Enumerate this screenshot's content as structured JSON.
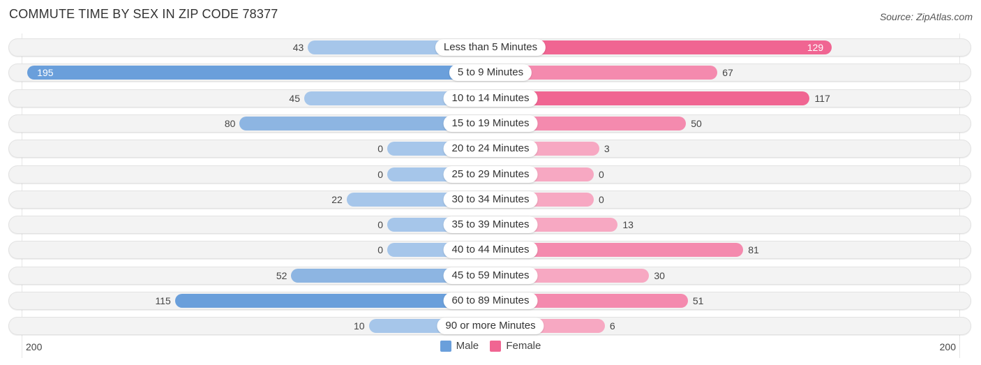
{
  "header": {
    "title": "COMMUTE TIME BY SEX IN ZIP CODE 78377",
    "source": "Source: ZipAtlas.com"
  },
  "colors": {
    "male": "#6a9fdb",
    "male_light": "#a6c6ea",
    "female": "#f06592",
    "female_light": "#f7a8c2"
  },
  "chart_data": {
    "type": "bar",
    "orientation": "horizontal-diverging",
    "title": "COMMUTE TIME BY SEX IN ZIP CODE 78377",
    "categories": [
      "Less than 5 Minutes",
      "5 to 9 Minutes",
      "10 to 14 Minutes",
      "15 to 19 Minutes",
      "20 to 24 Minutes",
      "25 to 29 Minutes",
      "30 to 34 Minutes",
      "35 to 39 Minutes",
      "40 to 44 Minutes",
      "45 to 59 Minutes",
      "60 to 89 Minutes",
      "90 or more Minutes"
    ],
    "series": [
      {
        "name": "Male",
        "values": [
          43,
          195,
          45,
          80,
          0,
          0,
          22,
          0,
          0,
          52,
          115,
          10
        ]
      },
      {
        "name": "Female",
        "values": [
          129,
          67,
          117,
          50,
          3,
          0,
          0,
          13,
          81,
          30,
          51,
          6
        ]
      }
    ],
    "axis": {
      "left_label": "200",
      "right_label": "200",
      "range": [
        0,
        200
      ]
    },
    "legend": [
      "Male",
      "Female"
    ],
    "legend_position": "bottom-center"
  }
}
